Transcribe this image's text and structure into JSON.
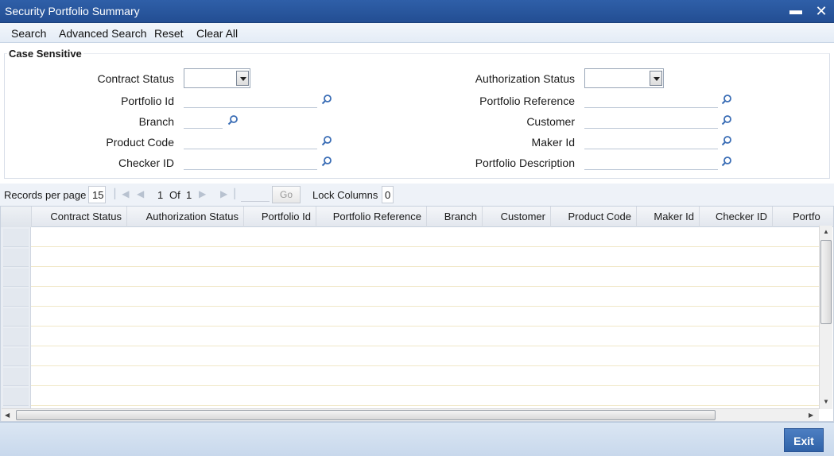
{
  "window": {
    "title": "Security Portfolio Summary",
    "minimize": "▬",
    "close": "✕"
  },
  "toolbar": {
    "search": "Search",
    "advanced_search": "Advanced Search",
    "reset": "Reset",
    "clear_all": "Clear All"
  },
  "criteria": {
    "legend": "Case Sensitive",
    "contract_status": "Contract Status",
    "authorization_status": "Authorization Status",
    "portfolio_id": "Portfolio Id",
    "portfolio_reference": "Portfolio Reference",
    "branch": "Branch",
    "customer": "Customer",
    "product_code": "Product Code",
    "maker_id": "Maker Id",
    "checker_id": "Checker ID",
    "portfolio_description": "Portfolio Description"
  },
  "pager": {
    "records_per_page_label": "Records per page",
    "records_per_page": "15",
    "current_page": "1",
    "of_label": "Of",
    "total_pages": "1",
    "go": "Go",
    "lock_columns_label": "Lock Columns",
    "lock_columns": "0"
  },
  "grid": {
    "columns": [
      "Contract Status",
      "Authorization Status",
      "Portfolio Id",
      "Portfolio Reference",
      "Branch",
      "Customer",
      "Product Code",
      "Maker Id",
      "Checker ID",
      "Portfo"
    ]
  },
  "footer": {
    "exit": "Exit"
  },
  "colors": {
    "titlebar": "#2a569c",
    "accent": "#3a6db5",
    "row_line": "#f1e8c8"
  }
}
